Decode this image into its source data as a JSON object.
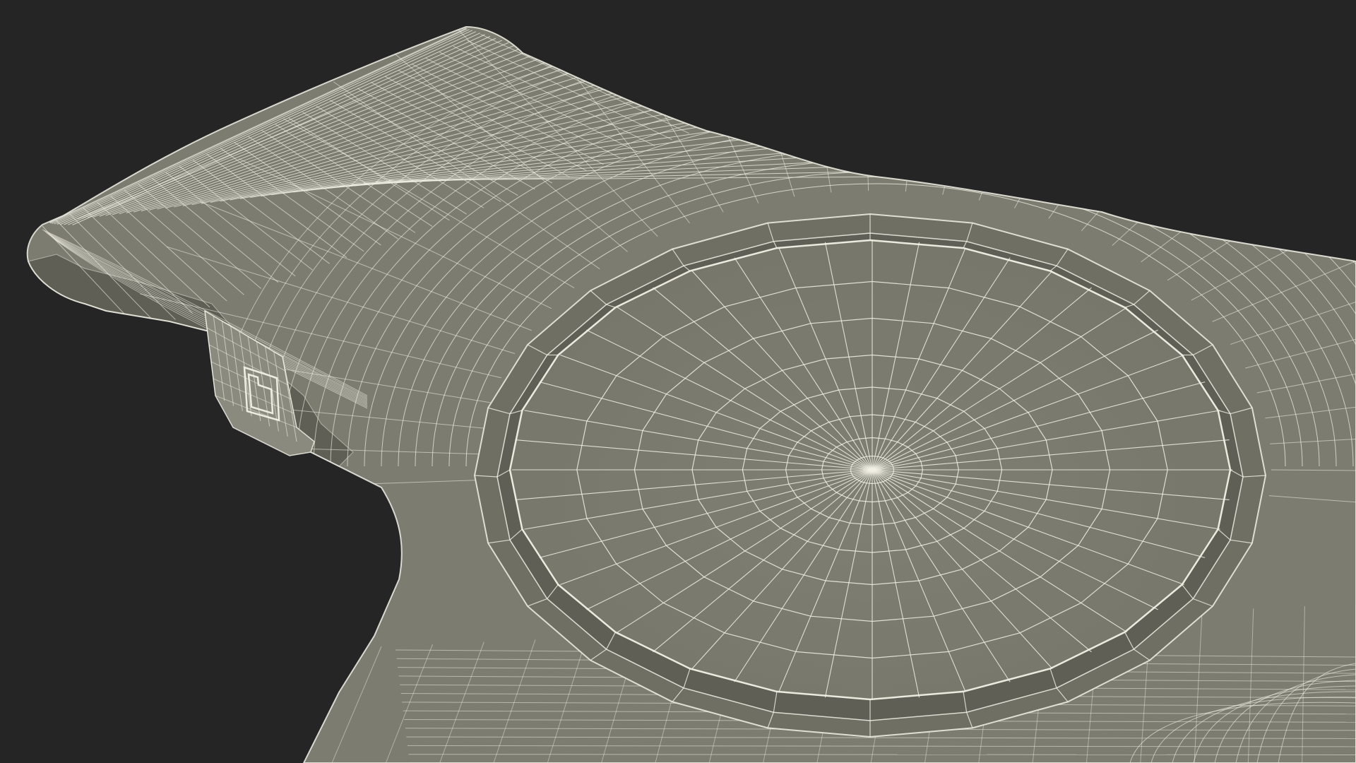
{
  "scene": {
    "background_color": "#252525",
    "surface_color": "#7c7c70",
    "surface_shadow_color": "#5f5f55",
    "surface_highlight_color": "#8a8a7e",
    "wire_color": "#f2f1e6",
    "wire_opacity": 0.85,
    "objects": [
      "mesh-body",
      "circular-recess",
      "side-port"
    ]
  }
}
